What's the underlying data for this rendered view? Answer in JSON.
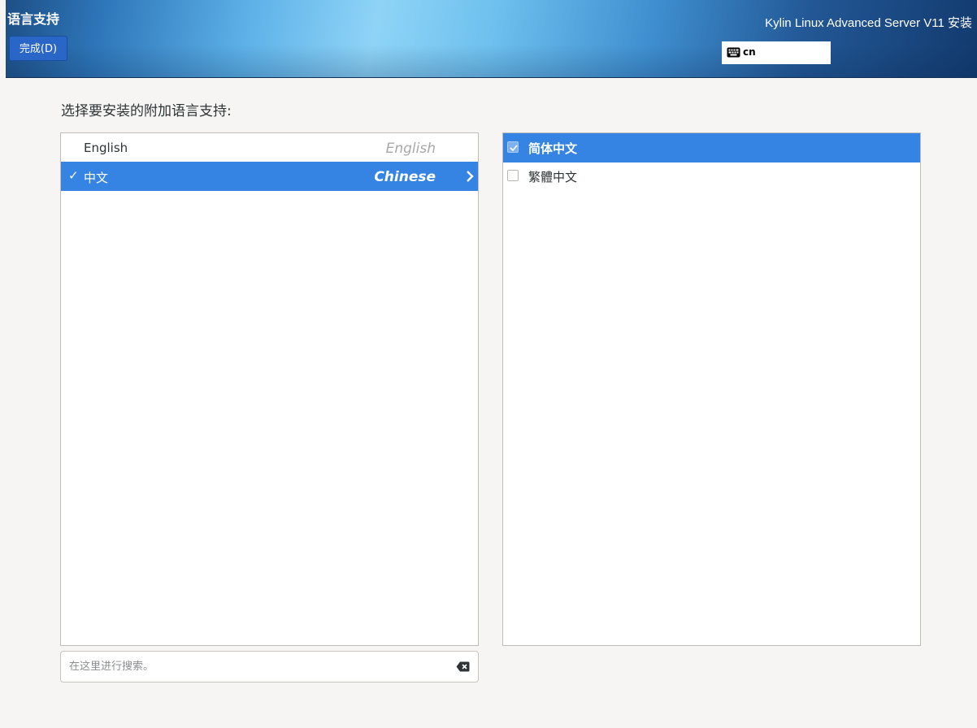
{
  "header": {
    "spoke_title": "语言支持",
    "done_button": "完成(D)",
    "product_title": "Kylin Linux Advanced Server V11 安装",
    "keyboard_layout": "cn",
    "keyboard_icon": "keyboard-icon"
  },
  "main": {
    "prompt": "选择要安装的附加语言支持:",
    "languages": [
      {
        "native": "English",
        "english": "English",
        "selected": false,
        "checked": false
      },
      {
        "native": "中文",
        "english": "Chinese",
        "selected": true,
        "checked": true
      }
    ],
    "locales": [
      {
        "label": "简体中文",
        "checked": true,
        "selected": true
      },
      {
        "label": "繁體中文",
        "checked": false,
        "selected": false
      }
    ],
    "search": {
      "placeholder": "在这里进行搜索。",
      "value": "",
      "clear_icon": "clear-icon"
    }
  },
  "colors": {
    "accent": "#3584e4",
    "done_button": "#2a66c8",
    "background": "#f6f5f4"
  }
}
